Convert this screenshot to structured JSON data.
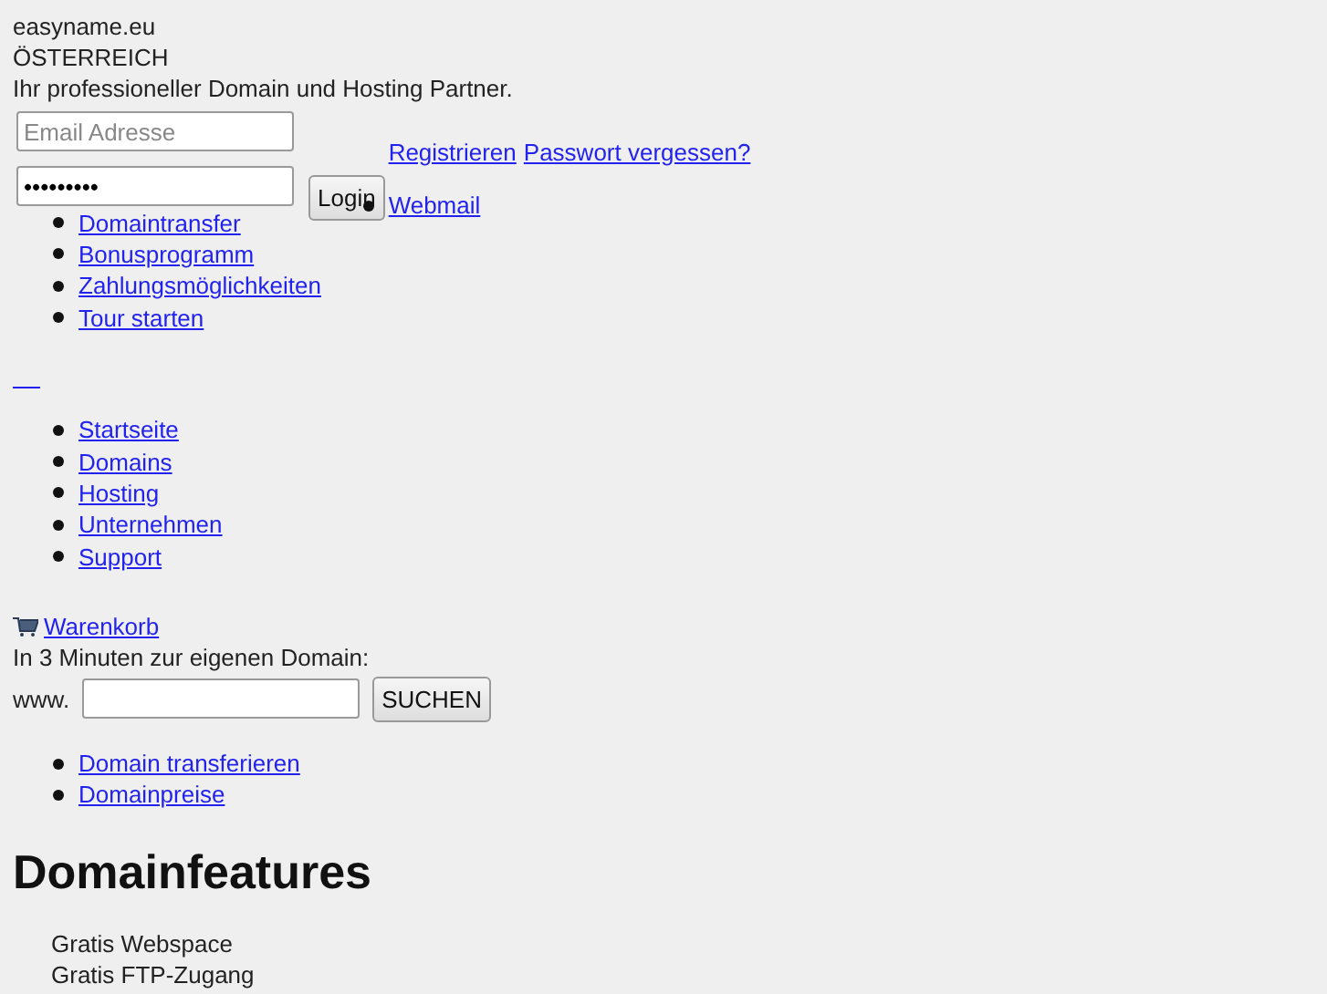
{
  "header": {
    "site_name": "easyname.eu",
    "country": "ÖSTERREICH",
    "tagline": "Ihr professioneller Domain und Hosting Partner."
  },
  "login": {
    "email": {
      "placeholder": "Email Adresse"
    },
    "password": {
      "value": "•••••••••"
    },
    "button": "Login",
    "links": [
      "Registrieren",
      "Passwort vergessen?"
    ],
    "menu": [
      "Webmail"
    ]
  },
  "top_links": [
    "Domaintransfer",
    "Bonusprogramm",
    "Zahlungsmöglichkeiten",
    "Tour starten"
  ],
  "nav": [
    "Startseite",
    "Domains",
    "Hosting",
    "Unternehmen",
    "Support"
  ],
  "cart": {
    "label": "Warenkorb"
  },
  "domain_search": {
    "prompt": "In 3 Minuten zur eigenen Domain:",
    "prefix": "www.",
    "button": "SUCHEN"
  },
  "domain_links": [
    "Domain transferieren",
    "Domainpreise"
  ],
  "features": {
    "heading": "Domainfeatures",
    "items": [
      "Gratis Webspace",
      "Gratis FTP-Zugang"
    ]
  }
}
